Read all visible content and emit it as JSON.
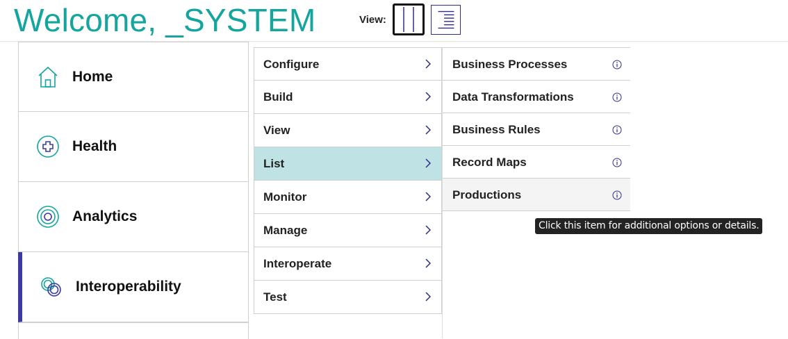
{
  "header": {
    "welcome": "Welcome, _SYSTEM",
    "view_label": "View:",
    "view_modes": [
      "columns-view",
      "list-view"
    ]
  },
  "colors": {
    "accent_teal": "#13a59e",
    "active_bar": "#3b3aa5",
    "selected_row": "#bfe3e4",
    "tooltip_bg": "#232323"
  },
  "leftnav": {
    "items": [
      {
        "label": "Home",
        "icon": "home-icon"
      },
      {
        "label": "Health",
        "icon": "health-icon"
      },
      {
        "label": "Analytics",
        "icon": "analytics-icon"
      },
      {
        "label": "Interoperability",
        "icon": "interoperability-icon",
        "active": true
      }
    ]
  },
  "midcol": {
    "items": [
      {
        "label": "Configure"
      },
      {
        "label": "Build"
      },
      {
        "label": "View"
      },
      {
        "label": "List",
        "selected": true
      },
      {
        "label": "Monitor"
      },
      {
        "label": "Manage"
      },
      {
        "label": "Interoperate"
      },
      {
        "label": "Test"
      }
    ]
  },
  "rightcol": {
    "items": [
      {
        "label": "Business Processes"
      },
      {
        "label": "Data Transformations"
      },
      {
        "label": "Business Rules"
      },
      {
        "label": "Record Maps"
      },
      {
        "label": "Productions",
        "hover": true
      }
    ]
  },
  "tooltip": {
    "text": "Click this item for additional options or details."
  }
}
